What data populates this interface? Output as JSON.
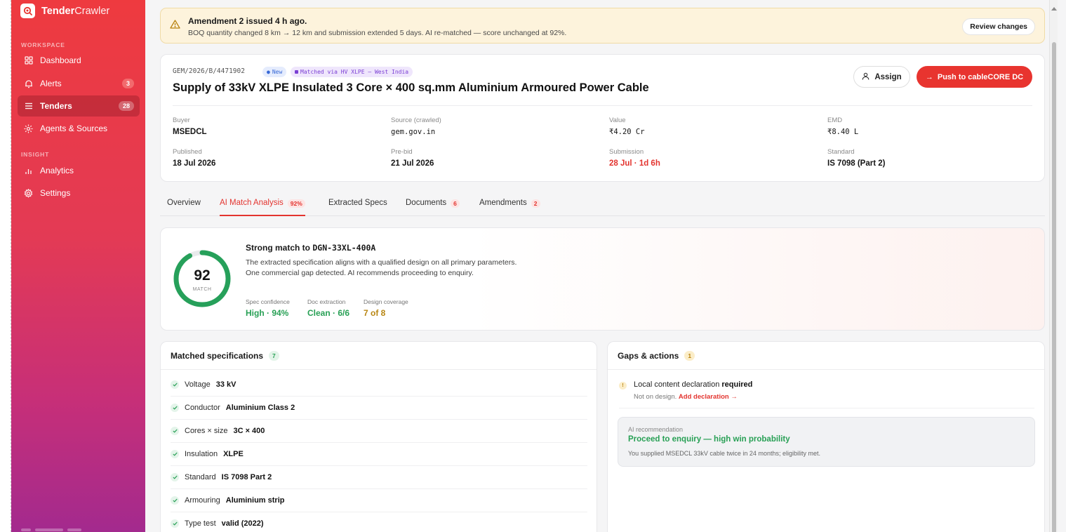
{
  "sidebar": {
    "brand_bold": "Tender",
    "brand_light": "Crawler",
    "workspace_label": "WORKSPACE",
    "insight_label": "INSIGHT",
    "workspace_items": [
      {
        "label": "Dashboard",
        "icon": "grid-icon"
      },
      {
        "label": "Alerts",
        "icon": "bell-icon",
        "badge": "3"
      },
      {
        "label": "Tenders",
        "icon": "list-icon",
        "badge": "28",
        "active": true
      },
      {
        "label": "Agents & Sources",
        "icon": "sun-icon"
      }
    ],
    "insight_items": [
      {
        "label": "Analytics",
        "icon": "bar-chart-icon"
      },
      {
        "label": "Settings",
        "icon": "gear-icon"
      }
    ]
  },
  "banner": {
    "title": "Amendment 2 issued 4 h ago.",
    "description": "BOQ quantity changed 8 km → 12 km and submission extended 5 days. AI re-matched — score unchanged at 92%.",
    "action_label": "Review changes"
  },
  "tender": {
    "reference": "GEM/2026/B/4471902",
    "new_pill": "New",
    "match_pill": "Matched via HV XLPE – West India",
    "title": "Supply of 33kV XLPE Insulated 3 Core × 400 sq.mm Aluminium Armoured Power Cable",
    "assign_label": "Assign",
    "push_label": "Push to cableCORE DC",
    "meta": {
      "buyer_label": "Buyer",
      "buyer": "MSEDCL",
      "source_label": "Source (crawled)",
      "source": "gem.gov.in",
      "value_label": "Value",
      "value": "₹4.20 Cr",
      "emd_label": "EMD",
      "emd": "₹8.40 L",
      "published_label": "Published",
      "published": "18 Jul 2026",
      "prebid_label": "Pre-bid",
      "prebid": "21 Jul 2026",
      "submission_label": "Submission",
      "submission": "28 Jul · 1d 6h",
      "standard_label": "Standard",
      "standard": "IS 7098 (Part 2)"
    }
  },
  "tabs": {
    "overview": "Overview",
    "ai_match": "AI Match Analysis",
    "ai_match_count": "92%",
    "extracted": "Extracted Specs",
    "documents": "Documents",
    "documents_count": "6",
    "amendments": "Amendments",
    "amendments_count": "2"
  },
  "match": {
    "score": "92",
    "score_fraction": 0.92,
    "score_label": "MATCH",
    "title_prefix": "Strong match to ",
    "design_code": "DGN-33XL-400A",
    "description": "The extracted specification aligns with a qualified design on all primary parameters. One commercial gap detected. AI recommends proceeding to enquiry.",
    "stats": [
      {
        "label": "Spec confidence",
        "value": "High · 94%"
      },
      {
        "label": "Doc extraction",
        "value": "Clean · 6/6"
      },
      {
        "label": "Design coverage",
        "value": "7 of 8"
      }
    ]
  },
  "specs": {
    "title": "Matched specifications",
    "count": "7",
    "items": [
      {
        "label": "Voltage",
        "value": "33 kV"
      },
      {
        "label": "Conductor",
        "value": "Aluminium Class 2"
      },
      {
        "label": "Cores × size",
        "value": "3C × 400"
      },
      {
        "label": "Insulation",
        "value": "XLPE"
      },
      {
        "label": "Standard",
        "value": "IS 7098 Part 2"
      },
      {
        "label": "Armouring",
        "value": "Aluminium strip"
      },
      {
        "label": "Type test",
        "value": "valid (2022)"
      }
    ]
  },
  "gaps": {
    "title": "Gaps & actions",
    "count": "1",
    "item_number": "!",
    "item_title": "Local content declaration",
    "item_status": "required",
    "item_sub": "Not on design.",
    "item_link": "Add declaration →",
    "reco_label": "AI recommendation",
    "reco_title": "Proceed to enquiry — high win probability",
    "reco_desc": "You supplied MSEDCL 33kV cable twice in 24 months; eligibility met."
  },
  "colors": {
    "accent": "#e8342f",
    "success": "#28a055",
    "warning": "#b88612",
    "banner_bg": "#fdf3dc"
  }
}
